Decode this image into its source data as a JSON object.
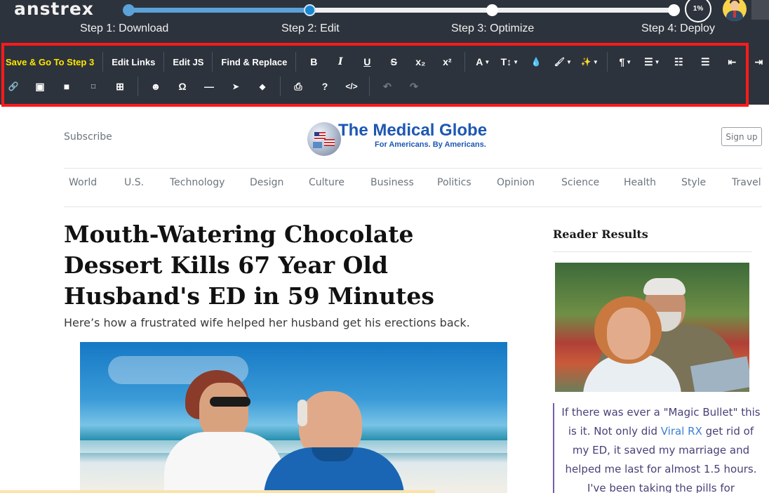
{
  "app": {
    "brand": "anstrex",
    "progress_percent": "1%",
    "steps": [
      {
        "label": "Step 1: Download",
        "state": "done"
      },
      {
        "label": "Step 2: Edit",
        "state": "current"
      },
      {
        "label": "Step 3: Optimize",
        "state": "todo"
      },
      {
        "label": "Step 4: Deploy",
        "state": "todo"
      }
    ],
    "avatar_icon": "user-avatar-icon"
  },
  "toolbar": {
    "save_label": "Save & Go To Step 3",
    "edit_links_label": "Edit Links",
    "edit_js_label": "Edit JS",
    "find_replace_label": "Find & Replace",
    "row1_icons": [
      {
        "name": "bold-icon",
        "glyph": "B"
      },
      {
        "name": "italic-icon",
        "glyph": "I"
      },
      {
        "name": "underline-icon",
        "glyph": "U"
      },
      {
        "name": "strikethrough-icon",
        "glyph": "S"
      },
      {
        "name": "subscript-icon",
        "glyph": "x₂"
      },
      {
        "name": "superscript-icon",
        "glyph": "x²"
      },
      {
        "name": "font-family-icon",
        "glyph": "A"
      },
      {
        "name": "font-size-icon",
        "glyph": "T↕"
      },
      {
        "name": "text-color-icon",
        "glyph": "💧"
      },
      {
        "name": "background-color-icon",
        "glyph": "🖌"
      },
      {
        "name": "inline-style-icon",
        "glyph": "✨"
      },
      {
        "name": "paragraph-format-icon",
        "glyph": "¶"
      },
      {
        "name": "align-icon",
        "glyph": "☰"
      },
      {
        "name": "ordered-list-icon",
        "glyph": "☷"
      },
      {
        "name": "unordered-list-icon",
        "glyph": "☰"
      },
      {
        "name": "outdent-icon",
        "glyph": "⇤"
      },
      {
        "name": "indent-icon",
        "glyph": "⇥"
      }
    ],
    "row2_icons": [
      {
        "name": "insert-link-icon",
        "glyph": "🔗"
      },
      {
        "name": "insert-image-icon",
        "glyph": "▣"
      },
      {
        "name": "insert-video-icon",
        "glyph": "■"
      },
      {
        "name": "insert-file-icon",
        "glyph": "□"
      },
      {
        "name": "insert-table-icon",
        "glyph": "⊞"
      },
      {
        "name": "emoticons-icon",
        "glyph": "☻"
      },
      {
        "name": "special-characters-icon",
        "glyph": "Ω"
      },
      {
        "name": "horizontal-line-icon",
        "glyph": "—"
      },
      {
        "name": "select-all-icon",
        "glyph": "➤"
      },
      {
        "name": "clear-formatting-icon",
        "glyph": "◆"
      },
      {
        "name": "print-icon",
        "glyph": "⎙"
      },
      {
        "name": "help-icon",
        "glyph": "?"
      },
      {
        "name": "code-view-icon",
        "glyph": "</>"
      },
      {
        "name": "undo-icon",
        "glyph": "↶"
      },
      {
        "name": "redo-icon",
        "glyph": "↷"
      }
    ]
  },
  "page": {
    "subscribe": "Subscribe",
    "logo_title": "The Medical Globe",
    "logo_tagline": "For Americans.  By Americans.",
    "signup": "Sign up",
    "nav": [
      "World",
      "U.S.",
      "Technology",
      "Design",
      "Culture",
      "Business",
      "Politics",
      "Opinion",
      "Science",
      "Health",
      "Style",
      "Travel"
    ],
    "headline": "Mouth-Watering Chocolate Dessert Kills 67 Year Old Husband's ED in 59 Minutes",
    "dek": "Here’s how a frustrated wife helped her husband get his erections back.",
    "sidebar_heading": "Reader Results",
    "quote_before": "If there was ever a \"Magic Bullet\" this is it. Not only did ",
    "quote_link": "Viral RX",
    "quote_after": " get rid of my ED, it saved my marriage and helped me last for almost 1.5 hours. I've been taking the pills for"
  },
  "colors": {
    "toolbar_bg": "#2d333c",
    "highlight": "#ffe600",
    "frame": "#ff1a1a",
    "logo_blue": "#1d57b3",
    "progress": "#1a86cf"
  }
}
